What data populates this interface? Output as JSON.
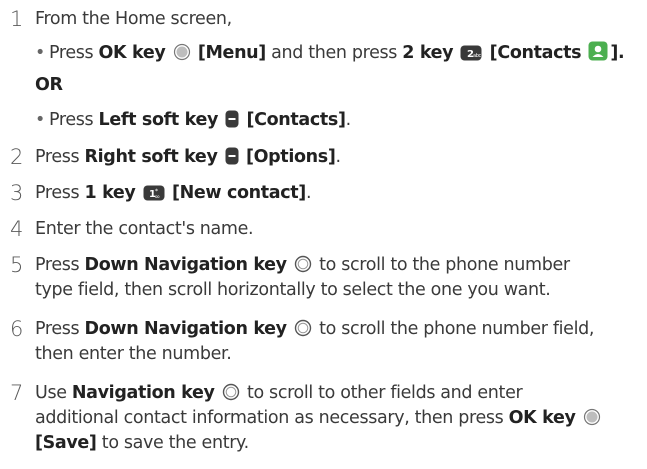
{
  "steps": [
    {
      "number": "1",
      "line1": "From the Home screen,",
      "sub_a": {
        "press": "Press ",
        "key1": "OK key",
        "label1": "[Menu]",
        "mid": " and then press ",
        "key2": "2 key",
        "label2": "[Contacts",
        "end": "]."
      },
      "or": "OR",
      "sub_b": {
        "press": "Press ",
        "key": "Left soft key",
        "label": "[Contacts]",
        "end": "."
      }
    },
    {
      "number": "2",
      "press": "Press ",
      "key": "Right soft key",
      "label": "[Options]",
      "end": "."
    },
    {
      "number": "3",
      "press": "Press ",
      "key": "1 key",
      "label": "[New contact]",
      "end": "."
    },
    {
      "number": "4",
      "text": "Enter the contact's name."
    },
    {
      "number": "5",
      "press": "Press ",
      "key": "Down Navigation key",
      "rest1": " to scroll to the phone number",
      "line2": "type field, then scroll horizontally to select the one you want."
    },
    {
      "number": "6",
      "press": "Press ",
      "key": "Down Navigation key",
      "rest1": " to scroll the phone number field,",
      "line2": "then enter the number."
    },
    {
      "number": "7",
      "use": "Use ",
      "key": "Navigation key",
      "rest1": " to scroll to other fields and enter",
      "line2a": "additional contact information as necessary, then press ",
      "key2": "OK key",
      "label": "[Save]",
      "line3rest": " to save the entry."
    }
  ],
  "icons": {
    "ok": "ok-key-icon",
    "two": "2-key-icon",
    "contacts": "contacts-app-icon",
    "left_soft": "left-soft-key-icon",
    "right_soft": "right-soft-key-icon",
    "one": "1-key-icon",
    "nav": "navigation-key-icon"
  },
  "colors": {
    "text": "#3a3a3a",
    "contacts_icon": "#4caf50"
  }
}
